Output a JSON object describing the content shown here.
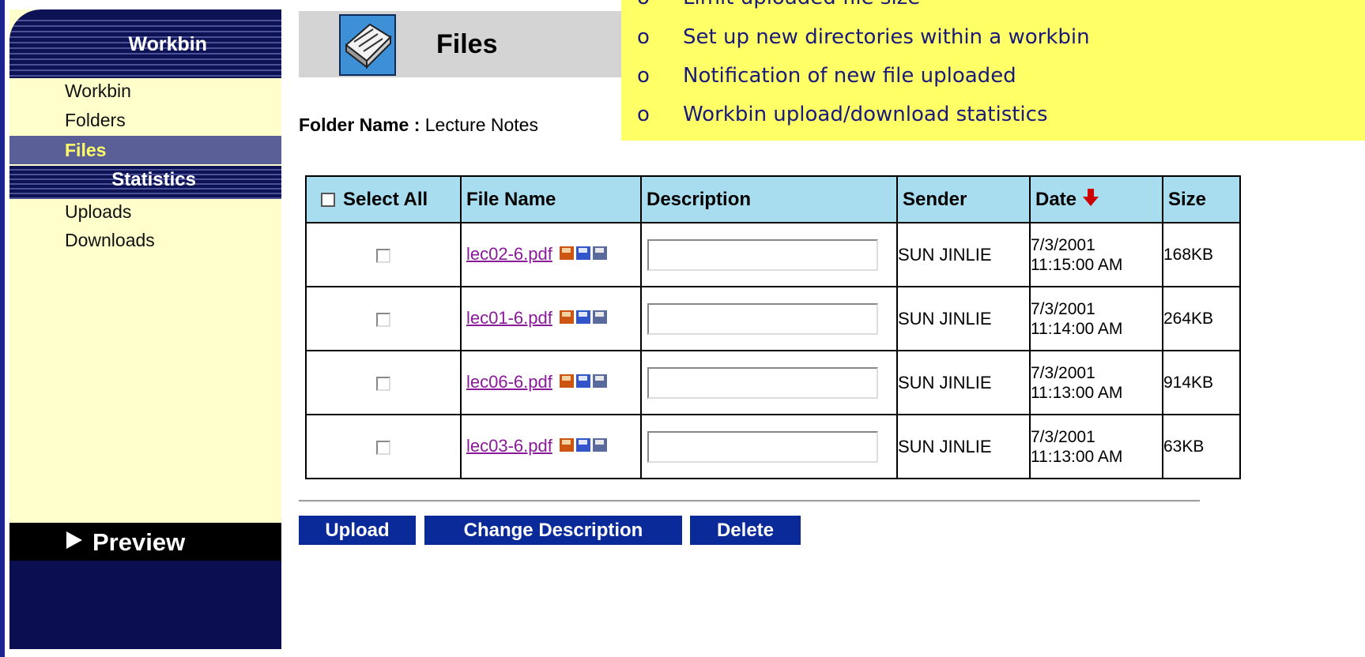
{
  "sidebar": {
    "title": "Workbin",
    "items": [
      {
        "label": "Workbin"
      },
      {
        "label": "Folders"
      },
      {
        "label": "Files"
      }
    ],
    "section": "Statistics",
    "stat_items": [
      {
        "label": "Uploads"
      },
      {
        "label": "Downloads"
      }
    ],
    "preview_label": "Preview"
  },
  "header": {
    "title": "Files"
  },
  "folder": {
    "label": "Folder Name :",
    "value": "Lecture Notes"
  },
  "note": {
    "bullet": "o",
    "items": [
      "Limit uploaded file size",
      "Set up new directories within a workbin",
      "Notification of new file uploaded",
      "Workbin upload/download statistics"
    ]
  },
  "table": {
    "headers": {
      "select_all": "Select All",
      "file_name": "File Name",
      "description": "Description",
      "sender": "Sender",
      "date": "Date",
      "size": "Size"
    },
    "rows": [
      {
        "file": "lec02-6.pdf",
        "description": "",
        "sender": "SUN JINLIE",
        "date": "7/3/2001",
        "time": "11:15:00 AM",
        "size": "168KB"
      },
      {
        "file": "lec01-6.pdf",
        "description": "",
        "sender": "SUN JINLIE",
        "date": "7/3/2001",
        "time": "11:14:00 AM",
        "size": "264KB"
      },
      {
        "file": "lec06-6.pdf",
        "description": "",
        "sender": "SUN JINLIE",
        "date": "7/3/2001",
        "time": "11:13:00 AM",
        "size": "914KB"
      },
      {
        "file": "lec03-6.pdf",
        "description": "",
        "sender": "SUN JINLIE",
        "date": "7/3/2001",
        "time": "11:13:00 AM",
        "size": "63KB"
      }
    ]
  },
  "buttons": {
    "upload": "Upload",
    "change_description": "Change Description",
    "delete": "Delete"
  },
  "colors": {
    "sidebar_bg": "#ffffcc",
    "sidebar_dark": "#0d1255",
    "active_item": "#5a5f98",
    "active_text": "#ffff66",
    "table_header": "#a8dcef",
    "note_bg": "#ffff66",
    "button_bg": "#0a2a9a",
    "link": "#8a1a9a",
    "sort_arrow": "#cc0000"
  },
  "icons": {
    "sort": "sort-descending-arrow-icon",
    "file_actions": "floppy-disk-icon",
    "header": "files-tray-icon"
  }
}
